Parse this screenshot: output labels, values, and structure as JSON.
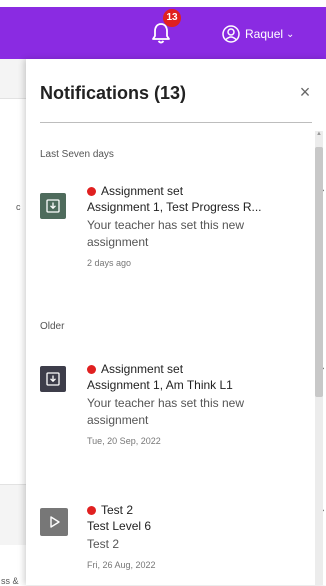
{
  "header": {
    "notification_count": "13",
    "user_name": "Raquel",
    "user_caret": "⌄"
  },
  "background": {
    "fragment_1": "c",
    "fragment_2": "ss &"
  },
  "panel": {
    "title": "Notifications (13)",
    "close_label": "×",
    "sections": [
      {
        "label": "Last Seven days",
        "items": [
          {
            "type": "Assignment set",
            "title": "Assignment 1, Test Progress R...",
            "message": "Your teacher has set this new assignment",
            "time": "2 days ago",
            "icon": "download-icon"
          }
        ]
      },
      {
        "label": "Older",
        "items": [
          {
            "type": "Assignment set",
            "title": "Assignment 1, Am Think L1",
            "message": "Your teacher has set this new assignment",
            "time": "Tue, 20 Sep, 2022",
            "icon": "download-icon"
          },
          {
            "type": "Test 2",
            "title": "Test Level 6",
            "message": "Test 2",
            "time": "Fri, 26 Aug, 2022",
            "icon": "play-icon"
          }
        ]
      }
    ]
  },
  "colors": {
    "header_bg": "#8a2be2",
    "badge": "#e02020",
    "unread_dot": "#e02020"
  }
}
